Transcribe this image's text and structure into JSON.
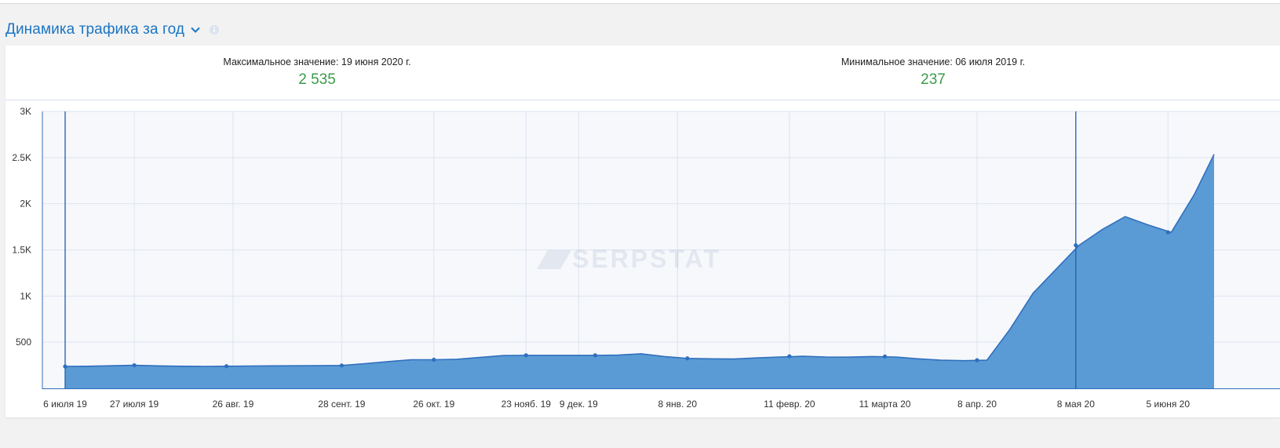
{
  "header": {
    "title": "Динамика трафика за год",
    "chevron_icon": "chevron-down-icon",
    "info_icon": "info-icon"
  },
  "stats": {
    "max_label": "Максимальное значение: 19 июня 2020 г.",
    "max_value": "2 535",
    "min_label": "Минимальное значение: 06 июля 2019 г.",
    "min_value": "237"
  },
  "watermark": "SERPSTAT",
  "colors": {
    "accent": "#1a75c4",
    "area_fill": "#5b9bd5",
    "line": "#2f6fbd",
    "value_green": "#3c9a4a"
  },
  "chart_data": {
    "type": "area",
    "x": [
      "2019-07-06",
      "2019-07-13",
      "2019-07-20",
      "2019-07-27",
      "2019-08-03",
      "2019-08-10",
      "2019-08-17",
      "2019-08-24",
      "2019-08-31",
      "2019-09-07",
      "2019-09-14",
      "2019-09-21",
      "2019-09-28",
      "2019-10-05",
      "2019-10-12",
      "2019-10-19",
      "2019-10-26",
      "2019-11-02",
      "2019-11-09",
      "2019-11-16",
      "2019-11-23",
      "2019-11-30",
      "2019-12-07",
      "2019-12-14",
      "2019-12-21",
      "2019-12-28",
      "2020-01-04",
      "2020-01-11",
      "2020-01-18",
      "2020-01-25",
      "2020-02-01",
      "2020-02-08",
      "2020-02-15",
      "2020-02-22",
      "2020-02-29",
      "2020-03-07",
      "2020-03-14",
      "2020-03-21",
      "2020-03-28",
      "2020-04-04",
      "2020-04-11",
      "2020-04-18",
      "2020-04-25",
      "2020-05-02",
      "2020-05-09",
      "2020-05-16",
      "2020-05-23",
      "2020-05-30",
      "2020-06-06",
      "2020-06-13",
      "2020-06-19"
    ],
    "values": [
      237,
      240,
      245,
      250,
      244,
      240,
      238,
      240,
      242,
      244,
      245,
      246,
      248,
      268,
      290,
      310,
      310,
      315,
      335,
      355,
      358,
      358,
      358,
      358,
      360,
      375,
      345,
      325,
      320,
      318,
      330,
      340,
      348,
      340,
      338,
      345,
      340,
      320,
      305,
      300,
      305,
      640,
      1030,
      1290,
      1550,
      1720,
      1860,
      1770,
      1690,
      2100,
      2535
    ],
    "markers": [
      {
        "x": "2019-07-06",
        "y": 237
      },
      {
        "x": "2019-07-27",
        "y": 250
      },
      {
        "x": "2019-08-24",
        "y": 240
      },
      {
        "x": "2019-09-28",
        "y": 248
      },
      {
        "x": "2019-10-26",
        "y": 310
      },
      {
        "x": "2019-11-23",
        "y": 358
      },
      {
        "x": "2019-12-14",
        "y": 358
      },
      {
        "x": "2020-01-11",
        "y": 325
      },
      {
        "x": "2020-02-11",
        "y": 348
      },
      {
        "x": "2020-03-11",
        "y": 345
      },
      {
        "x": "2020-04-08",
        "y": 305
      },
      {
        "x": "2020-05-08",
        "y": 1550
      },
      {
        "x": "2020-06-05",
        "y": 1690
      }
    ],
    "x_ticks": [
      {
        "x": "2019-07-06",
        "label": "6 июля 19"
      },
      {
        "x": "2019-07-27",
        "label": "27 июля 19"
      },
      {
        "x": "2019-08-26",
        "label": "26 авг. 19"
      },
      {
        "x": "2019-09-28",
        "label": "28 сент. 19"
      },
      {
        "x": "2019-10-26",
        "label": "26 окт. 19"
      },
      {
        "x": "2019-11-23",
        "label": "23 нояб. 19"
      },
      {
        "x": "2019-12-09",
        "label": "9 дек. 19"
      },
      {
        "x": "2020-01-08",
        "label": "8 янв. 20"
      },
      {
        "x": "2020-02-11",
        "label": "11 февр. 20"
      },
      {
        "x": "2020-03-11",
        "label": "11 марта 20"
      },
      {
        "x": "2020-04-08",
        "label": "8 апр. 20"
      },
      {
        "x": "2020-05-08",
        "label": "8 мая 20"
      },
      {
        "x": "2020-06-05",
        "label": "5 июня 20"
      }
    ],
    "y_ticks": [
      {
        "value": 500,
        "label": "500"
      },
      {
        "value": 1000,
        "label": "1K"
      },
      {
        "value": 1500,
        "label": "1.5K"
      },
      {
        "value": 2000,
        "label": "2K"
      },
      {
        "value": 2500,
        "label": "2.5K"
      },
      {
        "value": 3000,
        "label": "3K"
      }
    ],
    "ylim": [
      0,
      3000
    ],
    "vertical_markers": [
      "2019-07-06",
      "2020-05-08"
    ],
    "grid": true,
    "xlabel": "",
    "ylabel": ""
  }
}
